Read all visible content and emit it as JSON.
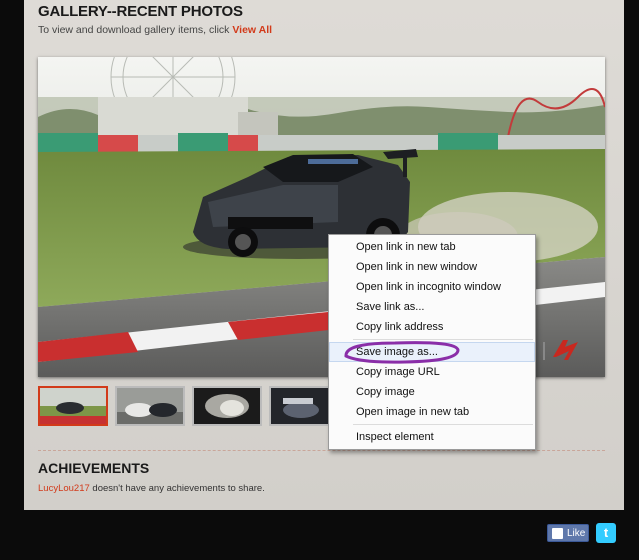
{
  "gallery": {
    "title": "GALLERY--RECENT PHOTOS",
    "subtitle": "To view and download gallery items, click",
    "view_all": "View All"
  },
  "achievements": {
    "title": "ACHIEVEMENTS",
    "username": "LucyLou217",
    "message": "doesn't have any achievements to share."
  },
  "context_menu": {
    "items": [
      "Open link in new tab",
      "Open link in new window",
      "Open link in incognito window",
      "Save link as...",
      "Copy link address",
      "Save image as...",
      "Copy image URL",
      "Copy image",
      "Open image in new tab",
      "Inspect element"
    ],
    "highlighted": "Save image as..."
  },
  "social": {
    "like_label": "Like",
    "twitter_icon": "t"
  },
  "colors": {
    "accent": "#d23a1a",
    "annotation": "#8a2ea8",
    "panel": "#d8d5d0",
    "background": "#0b0b0b"
  }
}
